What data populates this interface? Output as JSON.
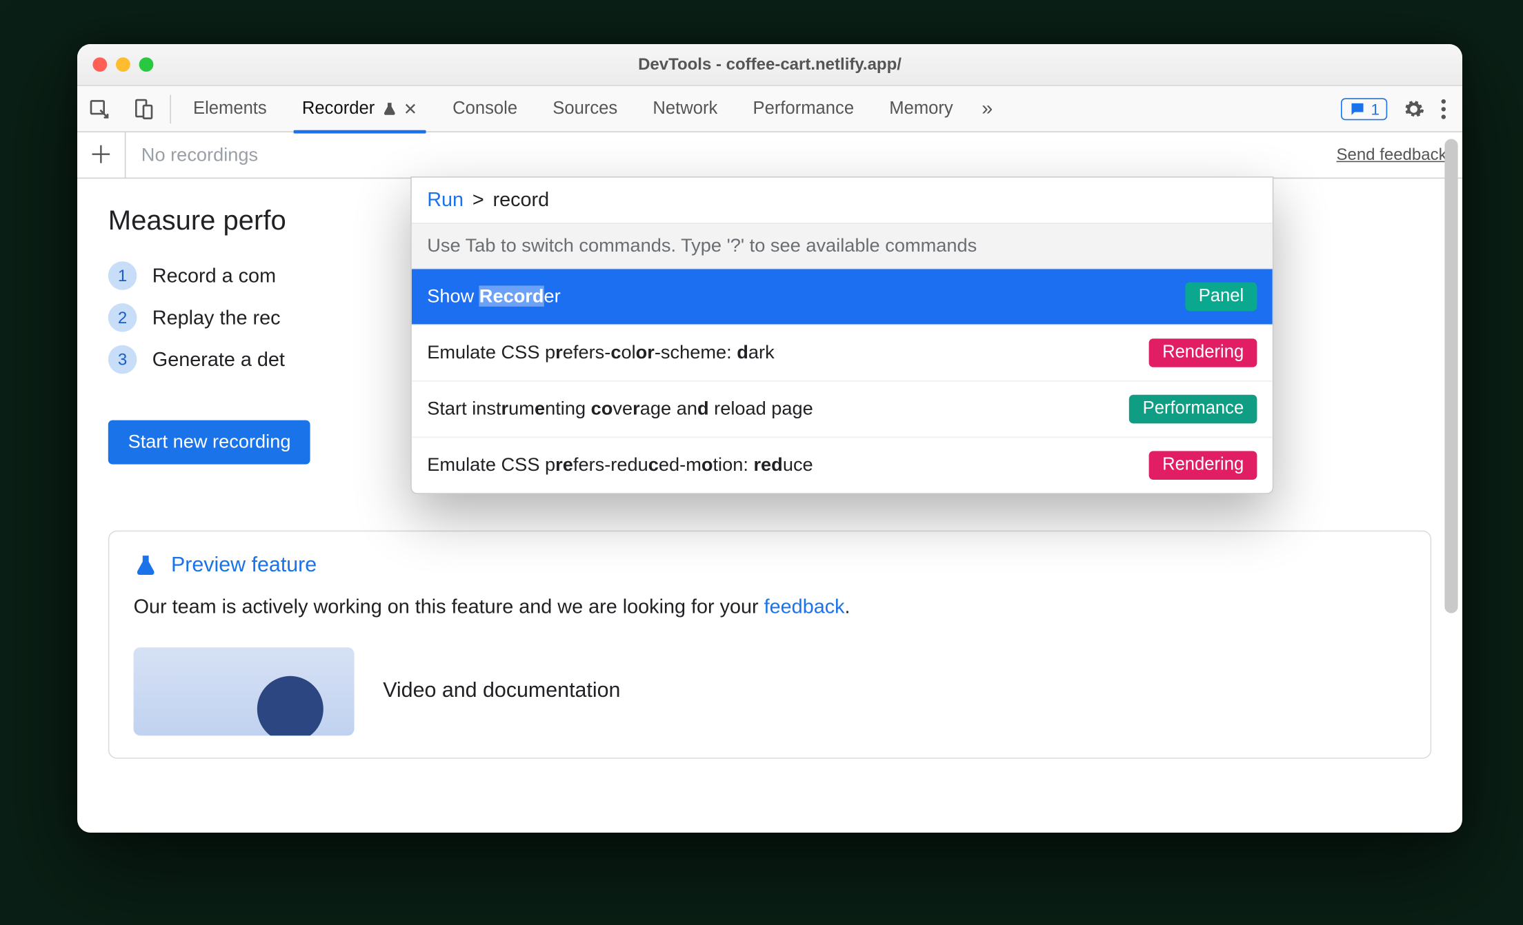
{
  "window": {
    "title": "DevTools - coffee-cart.netlify.app/"
  },
  "tabs": {
    "elements": "Elements",
    "recorder": "Recorder",
    "console": "Console",
    "sources": "Sources",
    "network": "Network",
    "performance": "Performance",
    "memory": "Memory"
  },
  "messages_count": "1",
  "subbar": {
    "no_recordings": "No recordings",
    "send_feedback": "Send feedback"
  },
  "recorder": {
    "heading": "Measure perfo",
    "step1": "Record a com",
    "step2": "Replay the rec",
    "step3": "Generate a det",
    "start_button": "Start new recording"
  },
  "preview": {
    "title": "Preview feature",
    "text_pre": "Our team is actively working on this feature and we are looking for your ",
    "link": "feedback",
    "text_post": ".",
    "doc_title": "Video and documentation"
  },
  "palette": {
    "run_label": "Run",
    "prefix": ">",
    "query": "record",
    "hint": "Use Tab to switch commands. Type '?' to see available commands",
    "items": [
      {
        "html": "Show <span class='match'><b>Record</b></span>er",
        "tag": "Panel",
        "tag_class": "tag-panel",
        "selected": true
      },
      {
        "html": "Emulate CSS p<b>r</b>efers-<b>c</b>ol<b>or</b>-scheme: <b>d</b>ark",
        "tag": "Rendering",
        "tag_class": "tag-render",
        "selected": false
      },
      {
        "html": "Start inst<b>r</b>um<b>e</b>nting <b>co</b>ve<b>r</b>age an<b>d</b> reload page",
        "tag": "Performance",
        "tag_class": "tag-perf",
        "selected": false
      },
      {
        "html": "Emulate CSS p<b>re</b>fers-redu<b>c</b>ed-m<b>o</b>tion: <b>red</b>uce",
        "tag": "Rendering",
        "tag_class": "tag-render",
        "selected": false
      }
    ]
  }
}
